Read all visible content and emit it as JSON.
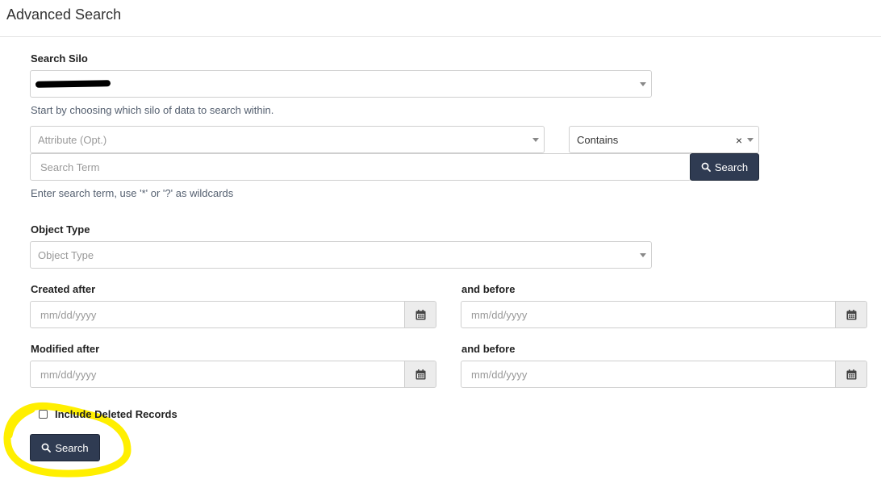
{
  "header": {
    "title": "Advanced Search"
  },
  "silo": {
    "label": "Search Silo",
    "help": "Start by choosing which silo of data to search within."
  },
  "attribute": {
    "placeholder": "Attribute (Opt.)"
  },
  "operator": {
    "value": "Contains",
    "clear": "×"
  },
  "search_term": {
    "placeholder": "Search Term",
    "button": "Search",
    "help": "Enter search term, use '*' or '?' as wildcards"
  },
  "object_type": {
    "label": "Object Type",
    "placeholder": "Object Type"
  },
  "created": {
    "after_label": "Created after",
    "before_label": "and before",
    "placeholder": "mm/dd/yyyy"
  },
  "modified": {
    "after_label": "Modified after",
    "before_label": "and before",
    "placeholder": "mm/dd/yyyy"
  },
  "include_deleted": {
    "label": "Include Deleted Records",
    "checked": false
  },
  "submit": {
    "label": "Search"
  },
  "colors": {
    "button": "#2f3b52",
    "highlight": "#ffef00",
    "help_text": "#556070"
  }
}
